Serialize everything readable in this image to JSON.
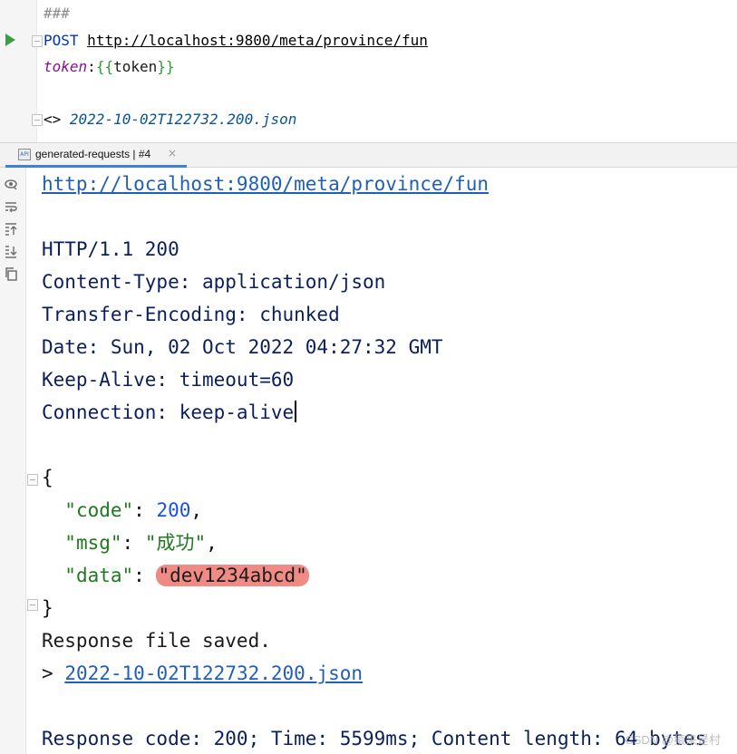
{
  "editor": {
    "separator": "###",
    "method": "POST",
    "url": "http://localhost:9800/meta/province/fun",
    "header_name": "token",
    "header_colon": ":",
    "brace_open": "{{",
    "header_value": "token",
    "brace_close": "}}",
    "redirect_prefix": "<>",
    "redirect_file": "2022-10-02T122732.200.json"
  },
  "tab": {
    "icon_text": "API",
    "label": "generated-requests | #4",
    "close_glyph": "×"
  },
  "toolbar": {
    "icons": [
      "eye-icon",
      "soft-wrap-icon",
      "scroll-to-top-icon",
      "scroll-to-end-icon",
      "copy-icon"
    ]
  },
  "response": {
    "url": "http://localhost:9800/meta/province/fun",
    "status_line": "HTTP/1.1 200",
    "headers": [
      "Content-Type: application/json",
      "Transfer-Encoding: chunked",
      "Date: Sun, 02 Oct 2022 04:27:32 GMT",
      "Keep-Alive: timeout=60",
      "Connection: keep-alive"
    ],
    "json": {
      "open": "{",
      "code_key": "\"code\"",
      "code_value": "200",
      "msg_key": "\"msg\"",
      "msg_value": "\"成功\"",
      "data_key": "\"data\"",
      "data_value": "\"dev1234abcd\"",
      "close": "}"
    },
    "saved_text": "Response file saved.",
    "saved_prefix": ">",
    "saved_file": "2022-10-02T122732.200.json",
    "summary": "Response code: 200; Time: 5599ms; Content length: 64 bytes"
  },
  "watermark": "CSDN @猿来是村",
  "colors": {
    "run_green": "#3e9c46",
    "tab_underline": "#4083c9",
    "highlight": "#f08a85",
    "link_blue": "#1f5fb8"
  }
}
